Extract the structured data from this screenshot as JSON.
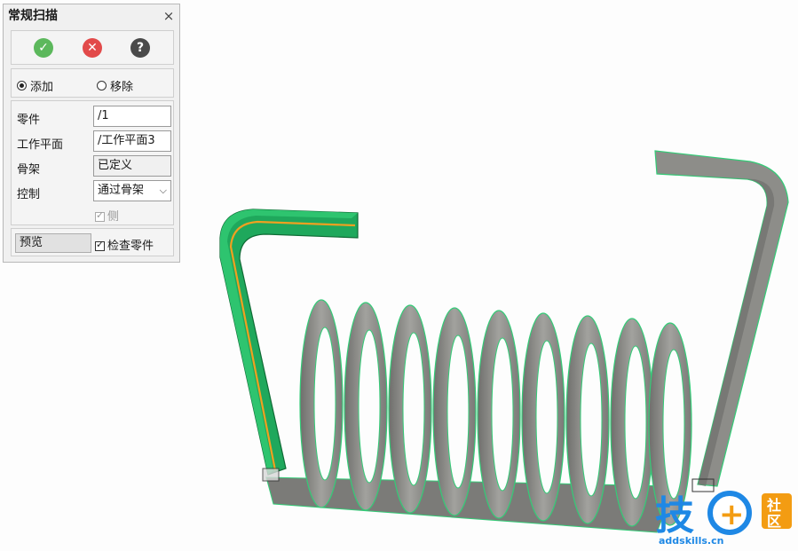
{
  "panel": {
    "title": "常规扫描",
    "close_label": "×",
    "actions": {
      "ok_glyph": "✓",
      "cancel_glyph": "✕",
      "help_glyph": "?"
    },
    "mode": {
      "add_label": "添加",
      "remove_label": "移除",
      "selected": "add"
    },
    "fields": {
      "part_label": "零件",
      "part_value": "/1",
      "workplane_label": "工作平面",
      "workplane_value": "/工作平面3",
      "skeleton_label": "骨架",
      "skeleton_value": "已定义",
      "control_label": "控制",
      "control_value": "通过骨架"
    },
    "side_label": "侧",
    "preview_label": "预览",
    "check_parts_label": "检查零件"
  },
  "watermark": {
    "glyph": "技",
    "plus": "+",
    "badge_top": "社",
    "badge_bottom": "区",
    "url": "addskills.cn"
  },
  "colors": {
    "accent_green": "#22a35a",
    "coil_gray": "#8a8a86",
    "path_orange": "#f0a020",
    "logo_blue": "#1e88e5",
    "logo_orange": "#f39c12"
  }
}
